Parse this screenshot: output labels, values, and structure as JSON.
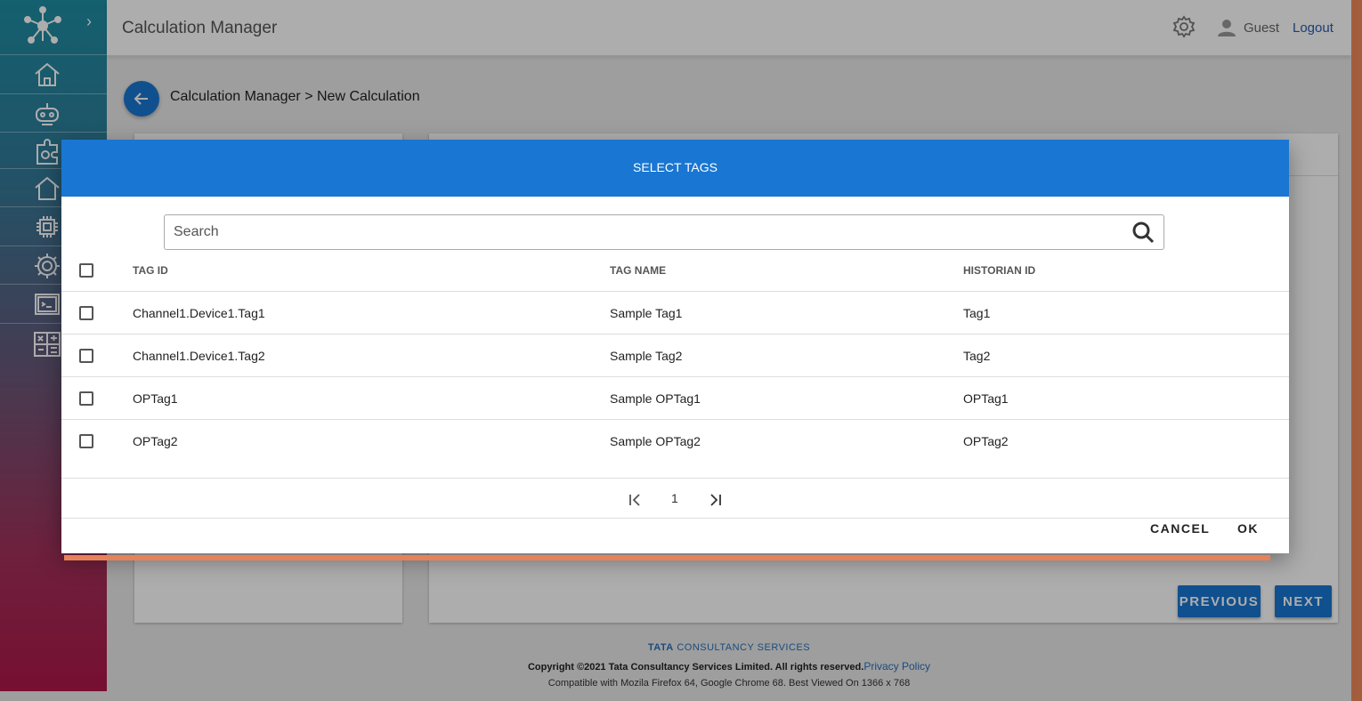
{
  "header": {
    "app_title": "Calculation Manager",
    "user_name": "Guest",
    "logout_label": "Logout",
    "icons": [
      "gear-icon",
      "user-icon"
    ]
  },
  "sidebar": {
    "logo_icon": "network-hub-icon",
    "items": [
      {
        "icon": "home-icon"
      },
      {
        "icon": "robot-icon"
      },
      {
        "icon": "puzzle-settings-icon"
      },
      {
        "icon": "home-outline-icon"
      },
      {
        "icon": "chip-icon"
      },
      {
        "icon": "gear-cog-icon"
      },
      {
        "icon": "terminal-icon"
      },
      {
        "icon": "calculator-icon"
      }
    ]
  },
  "breadcrumb": "Calculation Manager > New Calculation",
  "buttons": {
    "previous": "PREVIOUS",
    "next": "NEXT"
  },
  "footer": {
    "brand_bold": "TATA",
    "brand_rest": " CONSULTANCY SERVICES",
    "copyright": "Copyright ©2021 Tata Consultancy Services Limited. All rights reserved.",
    "privacy": "Privacy Policy",
    "compat": "Compatible with Mozila Firefox 64, Google Chrome 68. Best Viewed On 1366 x 768"
  },
  "dialog": {
    "title": "SELECT TAGS",
    "search_placeholder": "Search",
    "columns": [
      "TAG ID",
      "TAG NAME",
      "HISTORIAN ID"
    ],
    "rows": [
      [
        "Channel1.Device1.Tag1",
        "Sample Tag1",
        "Tag1"
      ],
      [
        "Channel1.Device1.Tag2",
        "Sample Tag2",
        "Tag2"
      ],
      [
        "OPTag1",
        "Sample OPTag1",
        "OPTag1"
      ],
      [
        "OPTag2",
        "Sample OPTag2",
        "OPTag2"
      ]
    ],
    "page": "1",
    "cancel_label": "CANCEL",
    "ok_label": "OK"
  },
  "colors": {
    "primary": "#1976d2",
    "accent": "#e6825a"
  }
}
